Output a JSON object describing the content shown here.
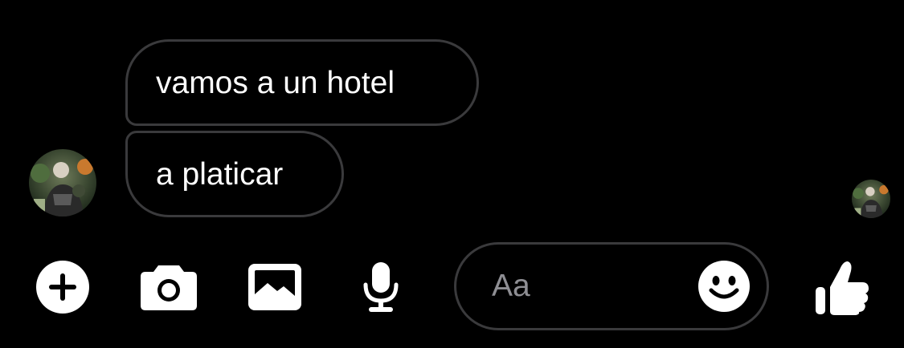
{
  "conversation": {
    "messages": [
      {
        "text": "vamos a un hotel"
      },
      {
        "text": "a platicar"
      }
    ]
  },
  "composer": {
    "placeholder": "Aa",
    "value": ""
  },
  "toolbar": {
    "icons": [
      "plus-icon",
      "camera-icon",
      "image-icon",
      "microphone-icon",
      "emoji-icon",
      "thumbs-up-icon"
    ]
  },
  "colors": {
    "background": "#000000",
    "bubble_border": "#3a3a3c",
    "text": "#ffffff",
    "placeholder": "#8e8e93",
    "icon": "#ffffff"
  }
}
